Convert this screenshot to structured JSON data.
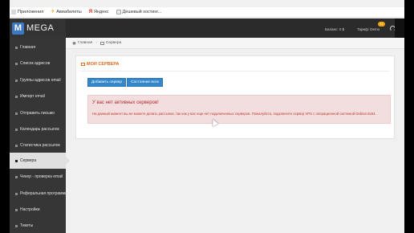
{
  "bookmarks": [
    {
      "label": "Приложения",
      "icon": "apps-grid-icon"
    },
    {
      "label": "Авиабилеты",
      "icon": "plane-icon"
    },
    {
      "label": "Яндекс",
      "icon": "yandex-icon"
    },
    {
      "label": "Дешевый хостинг...",
      "icon": "hosting-icon"
    }
  ],
  "brand": {
    "logo_letter": "M",
    "name": "MEGA",
    "accent": "#3b79c3"
  },
  "header": {
    "balance": "Баланс: 0 $",
    "tariff": "Тариф: Demo",
    "notification_count": "11"
  },
  "sidebar": {
    "items": [
      {
        "label": "Главная",
        "active": false
      },
      {
        "label": "Список адресов",
        "active": false
      },
      {
        "label": "Группы адресов email",
        "active": false
      },
      {
        "label": "Импорт email",
        "active": false
      },
      {
        "label": "Отправить письмо",
        "active": false
      },
      {
        "label": "Календарь рассылок",
        "active": false
      },
      {
        "label": "Статистика рассылок",
        "active": false
      },
      {
        "label": "Сервера",
        "active": true
      },
      {
        "label": "Чекер - проверка email",
        "active": false
      },
      {
        "label": "Реферальная программа",
        "active": false
      },
      {
        "label": "Настройки",
        "active": false
      },
      {
        "label": "Тикеты",
        "active": false
      }
    ]
  },
  "breadcrumb": {
    "home": "Главная",
    "current": "Сервера"
  },
  "main": {
    "title": "МОИ СЕРВЕРА",
    "buttons": {
      "add": "Добавить сервер",
      "status": "Состояние всех"
    },
    "alert": {
      "title": "У вас нет активных серверов!",
      "text": "На данный момент вы не можете делать рассылки, так как у вас еще нет подключенных серверов. Пожалуйста, подключите сервер VPS с операционной системой Debian 8x64."
    }
  },
  "colors": {
    "accent_orange": "#e06d1a",
    "button_blue": "#3487c9",
    "alert_red": "#b4292c",
    "sidebar_bg": "#363636"
  }
}
